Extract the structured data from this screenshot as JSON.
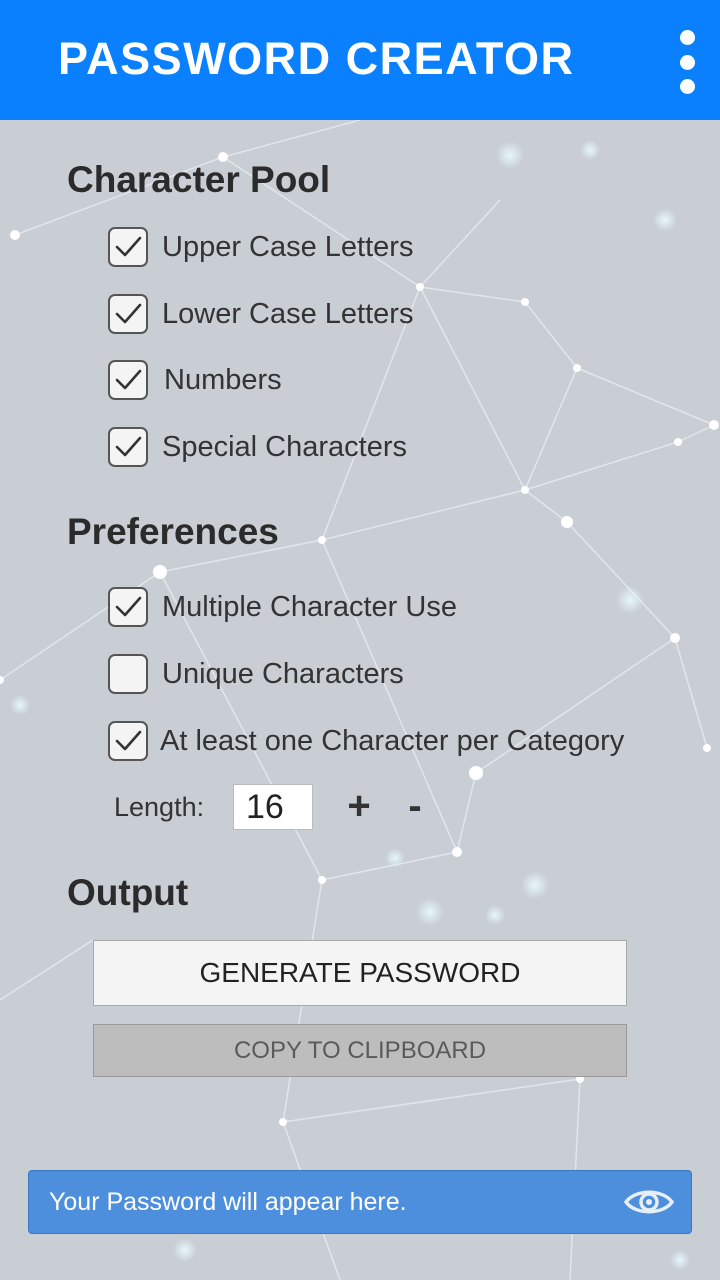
{
  "header": {
    "title": "PASSWORD CREATOR",
    "menu_icon": "more-vert-icon"
  },
  "character_pool": {
    "title": "Character Pool",
    "options": [
      {
        "label": "Upper Case Letters",
        "checked": true
      },
      {
        "label": "Lower Case Letters",
        "checked": true
      },
      {
        "label": "Numbers",
        "checked": true
      },
      {
        "label": "Special Characters",
        "checked": true
      }
    ]
  },
  "preferences": {
    "title": "Preferences",
    "options": [
      {
        "label": "Multiple Character Use",
        "checked": true
      },
      {
        "label": "Unique Characters",
        "checked": false
      },
      {
        "label": "At least one Character per Category",
        "checked": true
      }
    ],
    "length_label": "Length:",
    "length_value": "16",
    "increment_label": "+",
    "decrement_label": "-"
  },
  "output": {
    "title": "Output",
    "generate_label": "GENERATE PASSWORD",
    "copy_label": "COPY TO CLIPBOARD",
    "password_placeholder": "Your Password will appear here.",
    "visibility_icon": "eye-icon"
  },
  "colors": {
    "header_bg": "#0a80ff",
    "background": "#c9ced5",
    "output_bar": "#4d8fdc",
    "network_lines": "#ffffff"
  }
}
